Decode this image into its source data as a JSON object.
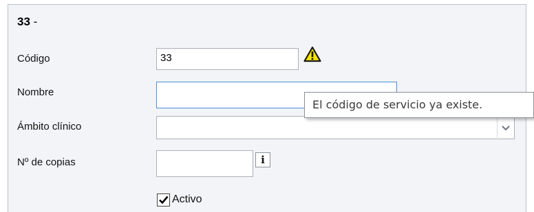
{
  "form": {
    "title_code": "33",
    "title_separator": "-",
    "fields": {
      "codigo": {
        "label": "Código",
        "value": "33"
      },
      "nombre": {
        "label": "Nombre",
        "value": ""
      },
      "ambito": {
        "label": "Ámbito clínico",
        "value": ""
      },
      "copias": {
        "label": "Nº de copias",
        "value": ""
      }
    },
    "info_button_glyph": "i",
    "activo": {
      "label": "Activo",
      "checked": true
    }
  },
  "tooltip": {
    "text": "El código de servicio ya existe."
  },
  "icons": {
    "warning": "warning-triangle-icon",
    "dropdown": "chevron-down-icon",
    "info": "info-icon",
    "checkmark": "checkmark-icon"
  },
  "colors": {
    "panel_bg": "#f2f4f7",
    "focus_border": "#4a8dd6",
    "warning_fill": "#f5e300"
  }
}
